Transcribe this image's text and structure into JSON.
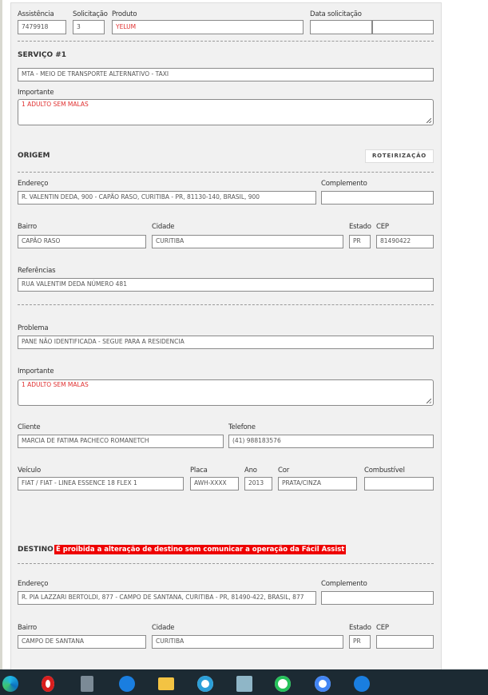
{
  "header": {
    "assistencia_label": "Assistência",
    "assistencia": "7479918",
    "solicitacao_label": "Solicitação",
    "solicitacao": "3",
    "produto_label": "Produto",
    "produto": "YELUM",
    "data_label": "Data solicitação",
    "data1": "",
    "data2": ""
  },
  "servico": {
    "title": "SERVIÇO #1",
    "tipo": "MTA - MEIO DE TRANSPORTE ALTERNATIVO - TAXI",
    "importante_label": "Importante",
    "importante": "1 ADULTO SEM MALAS"
  },
  "origem": {
    "title": "ORIGEM",
    "roteirizacao": "ROTEIRIZAÇÃO",
    "endereco_label": "Endereço",
    "endereco": "R. VALENTIN DEDA, 900 - CAPÃO RASO, CURITIBA - PR, 81130-140, BRASIL, 900",
    "complemento_label": "Complemento",
    "complemento": "",
    "bairro_label": "Bairro",
    "bairro": "CAPÃO RASO",
    "cidade_label": "Cidade",
    "cidade": "CURITIBA",
    "estado_label": "Estado",
    "estado": "PR",
    "cep_label": "CEP",
    "cep": "81490422",
    "referencias_label": "Referências",
    "referencias": "RUA VALENTIM DEDA NÚMERO 481"
  },
  "detalhes": {
    "problema_label": "Problema",
    "problema": "PANE NÃO IDENTIFICADA - SEGUE PARA A RESIDENCIA",
    "importante_label": "Importante",
    "importante": "1 ADULTO SEM MALAS",
    "cliente_label": "Cliente",
    "cliente": "MARCIA DE FATIMA PACHECO ROMANETCH",
    "telefone_label": "Telefone",
    "telefone": "(41) 988183576",
    "veiculo_label": "Veículo",
    "veiculo": "FIAT / FIAT - LINEA ESSENCE 18 FLEX 1",
    "placa_label": "Placa",
    "placa": "AWH-XXXX",
    "ano_label": "Ano",
    "ano": "2013",
    "cor_label": "Cor",
    "cor": "PRATA/CINZA",
    "combustivel_label": "Combustível",
    "combustivel": ""
  },
  "destino": {
    "title": "DESTINO",
    "warning": "É proibida a alteração de destino sem comunicar a operação da Fácil Assist",
    "endereco_label": "Endereço",
    "endereco": "R. PIA LAZZARI BERTOLDI, 877 - CAMPO DE SANTANA, CURITIBA - PR, 81490-422, BRASIL, 877",
    "complemento_label": "Complemento",
    "complemento": "",
    "bairro_label": "Bairro",
    "bairro": "CAMPO DE SANTANA",
    "cidade_label": "Cidade",
    "cidade": "CURITIBA",
    "estado_label": "Estado",
    "estado": "PR",
    "cep_label": "CEP",
    "cep": ""
  },
  "taskbar": {
    "icons": [
      "edge-icon",
      "opera-icon",
      "calculator-icon",
      "phone-icon",
      "file-explorer-icon",
      "chrome-profile-icon",
      "notepad-icon",
      "whatsapp-icon",
      "google-maps-icon",
      "phone-icon"
    ]
  },
  "colors": {
    "warning_bg": "#ee0000",
    "required_text": "#e03030",
    "taskbar": "#1c2a33"
  }
}
